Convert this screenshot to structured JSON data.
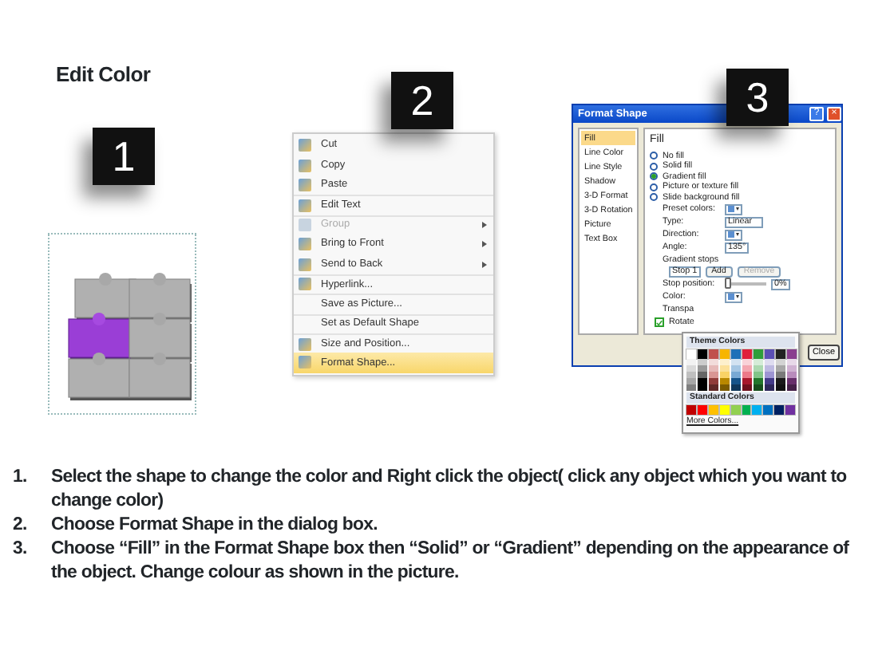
{
  "title": "Edit Color",
  "steps": [
    {
      "number": "1"
    },
    {
      "number": "2"
    },
    {
      "number": "3"
    }
  ],
  "puzzle": {
    "pieces": [
      {
        "selected": false
      },
      {
        "selected": false
      },
      {
        "selected": true
      },
      {
        "selected": false
      },
      {
        "selected": false
      },
      {
        "selected": false
      }
    ]
  },
  "context_menu": {
    "items": [
      {
        "label": "Cut",
        "has_icon": true,
        "disabled": false,
        "highlighted": false,
        "submenu": false,
        "divider_above": false
      },
      {
        "label": "Copy",
        "has_icon": true,
        "disabled": false,
        "highlighted": false,
        "submenu": false,
        "divider_above": false
      },
      {
        "label": "Paste",
        "has_icon": true,
        "disabled": false,
        "highlighted": false,
        "submenu": false,
        "divider_above": false
      },
      {
        "label": "Edit Text",
        "has_icon": true,
        "disabled": false,
        "highlighted": false,
        "submenu": false,
        "divider_above": true
      },
      {
        "label": "Group",
        "has_icon": true,
        "disabled": true,
        "highlighted": false,
        "submenu": true,
        "divider_above": true
      },
      {
        "label": "Bring to Front",
        "has_icon": true,
        "disabled": false,
        "highlighted": false,
        "submenu": true,
        "divider_above": false
      },
      {
        "label": "Send to Back",
        "has_icon": true,
        "disabled": false,
        "highlighted": false,
        "submenu": true,
        "divider_above": false
      },
      {
        "label": "Hyperlink...",
        "has_icon": true,
        "disabled": false,
        "highlighted": false,
        "submenu": false,
        "divider_above": true
      },
      {
        "label": "Save as Picture...",
        "has_icon": false,
        "disabled": false,
        "highlighted": false,
        "submenu": false,
        "divider_above": true
      },
      {
        "label": "Set as Default Shape",
        "has_icon": false,
        "disabled": false,
        "highlighted": false,
        "submenu": false,
        "divider_above": true
      },
      {
        "label": "Size and Position...",
        "has_icon": true,
        "disabled": false,
        "highlighted": false,
        "submenu": false,
        "divider_above": true
      },
      {
        "label": "Format Shape...",
        "has_icon": true,
        "disabled": false,
        "highlighted": true,
        "submenu": false,
        "divider_above": false
      }
    ]
  },
  "dialog": {
    "title": "Format Shape",
    "help_button": "?",
    "close_button": "×",
    "sidebar": [
      {
        "label": "Fill",
        "selected": true
      },
      {
        "label": "Line Color",
        "selected": false
      },
      {
        "label": "Line Style",
        "selected": false
      },
      {
        "label": "Shadow",
        "selected": false
      },
      {
        "label": "3-D Format",
        "selected": false
      },
      {
        "label": "3-D Rotation",
        "selected": false
      },
      {
        "label": "Picture",
        "selected": false
      },
      {
        "label": "Text Box",
        "selected": false
      }
    ],
    "heading": "Fill",
    "options": [
      {
        "label": "No fill",
        "selected": false
      },
      {
        "label": "Solid fill",
        "selected": false
      },
      {
        "label": "Gradient fill",
        "selected": true
      },
      {
        "label": "Picture or texture fill",
        "selected": false
      },
      {
        "label": "Slide background fill",
        "selected": false
      }
    ],
    "preset_colors": {
      "label": "Preset colors:"
    },
    "type": {
      "label": "Type:",
      "value": "Linear"
    },
    "direction": {
      "label": "Direction:"
    },
    "angle": {
      "label": "Angle:",
      "value": "135°"
    },
    "gradient_stops": {
      "label": "Gradient stops",
      "stop": "Stop 1",
      "add": "Add",
      "remove": "Remove",
      "remove_disabled": true
    },
    "stop_position": {
      "label": "Stop position:",
      "level": 0,
      "value": "0%"
    },
    "color": {
      "label": "Color:"
    },
    "transparency": {
      "label": "Transpa"
    },
    "rotate": {
      "label": "Rotate",
      "checked": true
    },
    "close": "Close"
  },
  "palette": {
    "theme_heading": "Theme Colors",
    "theme_colors": [
      {
        "color": "#ffffff"
      },
      {
        "color": "#000000"
      },
      {
        "color": "#c0504d"
      },
      {
        "color": "#f7b500"
      },
      {
        "color": "#1f70b8"
      },
      {
        "color": "#e0203a"
      },
      {
        "color": "#2e9e3a"
      },
      {
        "color": "#5b4fb5"
      },
      {
        "color": "#222222"
      },
      {
        "color": "#8a3f8f"
      }
    ],
    "standard_heading": "Standard Colors",
    "standard_colors": [
      {
        "color": "#c00000"
      },
      {
        "color": "#ff0000"
      },
      {
        "color": "#ffc000"
      },
      {
        "color": "#ffff00"
      },
      {
        "color": "#92d050"
      },
      {
        "color": "#00b050"
      },
      {
        "color": "#00b0f0"
      },
      {
        "color": "#0070c0"
      },
      {
        "color": "#002060"
      },
      {
        "color": "#7030a0"
      }
    ],
    "more": "More Colors..."
  },
  "instructions": [
    {
      "number": "1.",
      "text": "Select the shape to change the color and Right click the object( click any object which you want to change color)"
    },
    {
      "number": "2.",
      "text": "Choose Format Shape in the dialog box."
    },
    {
      "number": "3.",
      "text": "Choose “Fill” in the Format Shape box then “Solid” or “Gradient” depending on the appearance of the object. Change colour as shown in the picture."
    }
  ]
}
